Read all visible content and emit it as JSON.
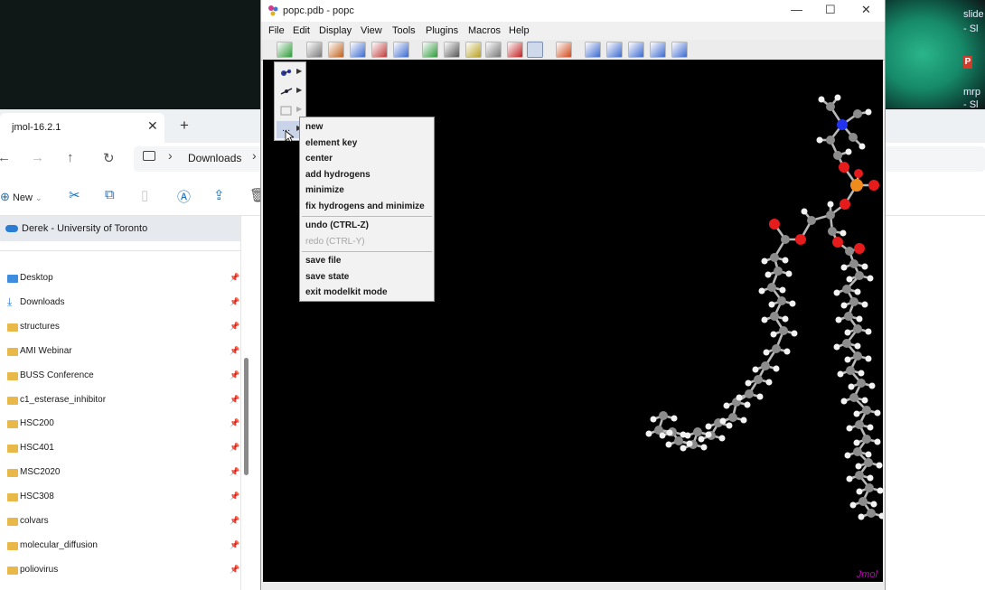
{
  "desktop": {
    "right_icons": [
      "slide",
      "- Sl",
      "mrp",
      "- Sl"
    ],
    "badge": "P"
  },
  "explorer": {
    "tab_title": "jmol-16.2.1",
    "tab_close": "✕",
    "new_tab": "+",
    "breadcrumb": "Downloads",
    "new_button": "New",
    "onedrive_label": "Derek - University of Toronto",
    "sidebar": [
      {
        "label": "Desktop",
        "icon": "desktop-folder-icon"
      },
      {
        "label": "Downloads",
        "icon": "download-icon"
      },
      {
        "label": "structures",
        "icon": "folder-icon"
      },
      {
        "label": "AMI Webinar",
        "icon": "folder-icon"
      },
      {
        "label": "BUSS Conference",
        "icon": "folder-icon"
      },
      {
        "label": "c1_esterase_inhibitor",
        "icon": "folder-icon"
      },
      {
        "label": "HSC200",
        "icon": "folder-icon"
      },
      {
        "label": "HSC401",
        "icon": "folder-icon"
      },
      {
        "label": "MSC2020",
        "icon": "folder-icon"
      },
      {
        "label": "HSC308",
        "icon": "folder-icon"
      },
      {
        "label": "colvars",
        "icon": "folder-icon"
      },
      {
        "label": "molecular_diffusion",
        "icon": "folder-icon"
      },
      {
        "label": "poliovirus",
        "icon": "folder-icon"
      }
    ]
  },
  "jmol": {
    "title": "popc.pdb - popc",
    "menus": [
      "File",
      "Edit",
      "Display",
      "View",
      "Tools",
      "Plugins",
      "Macros",
      "Help"
    ],
    "watermark": "Jmol",
    "modelkit_more": "...",
    "popup": {
      "group1": [
        "new",
        "element key",
        "center",
        "add hydrogens",
        "minimize",
        "fix hydrogens and minimize"
      ],
      "undo": "undo (CTRL-Z)",
      "redo": "redo (CTRL-Y)",
      "group3": [
        "save file",
        "save state",
        "exit modelkit mode"
      ]
    },
    "atom_colors": {
      "carbon": "#8c8c8c",
      "hydrogen": "#f2f2f2",
      "oxygen": "#e61b1b",
      "nitrogen": "#2233ee",
      "phosphorus": "#f08c1e"
    }
  }
}
